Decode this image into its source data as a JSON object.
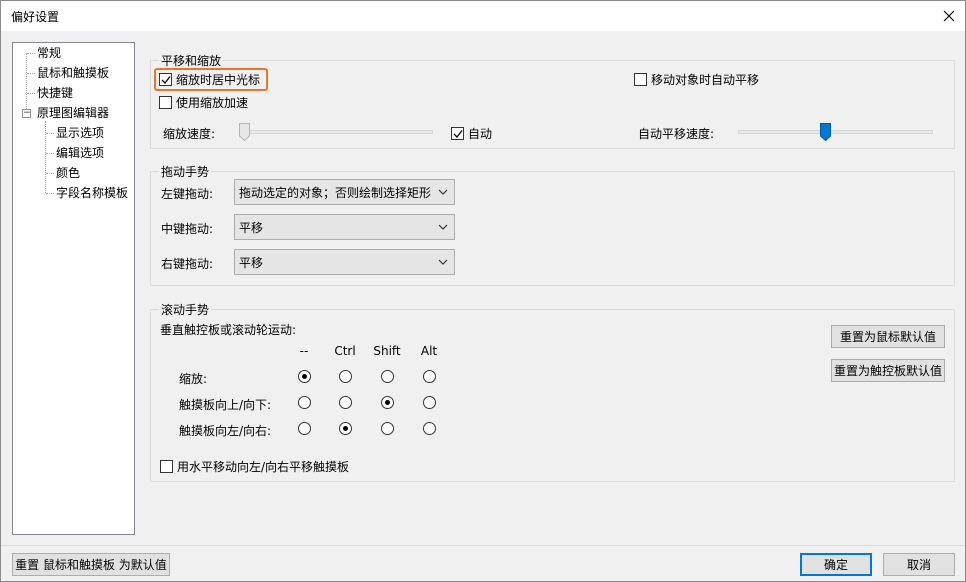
{
  "window": {
    "title": "偏好设置"
  },
  "tree": {
    "items": [
      {
        "label": "常规"
      },
      {
        "label": "鼠标和触摸板"
      },
      {
        "label": "快捷键"
      },
      {
        "label": "原理图编辑器",
        "expander": "−"
      },
      {
        "label": "显示选项"
      },
      {
        "label": "编辑选项"
      },
      {
        "label": "颜色"
      },
      {
        "label": "字段名称模板"
      }
    ]
  },
  "pan_zoom": {
    "title": "平移和缩放",
    "zoom_center_cursor": {
      "label": "缩放时居中光标",
      "checked": true
    },
    "use_zoom_accel": {
      "label": "使用缩放加速",
      "checked": false
    },
    "auto_pan_move": {
      "label": "移动对象时自动平移",
      "checked": false
    },
    "zoom_speed_label": "缩放速度:",
    "zoom_speed_value": 0.0,
    "auto": {
      "label": "自动",
      "checked": true
    },
    "auto_pan_speed_label": "自动平移速度:",
    "auto_pan_speed_value": 0.45
  },
  "drag": {
    "title": "拖动手势",
    "left": {
      "label": "左键拖动:",
      "value": "拖动选定的对象；否则绘制选择矩形"
    },
    "middle": {
      "label": "中键拖动:",
      "value": "平移"
    },
    "right": {
      "label": "右键拖动:",
      "value": "平移"
    }
  },
  "scroll": {
    "title": "滚动手势",
    "subtitle": "垂直触控板或滚动轮运动:",
    "columns": [
      "--",
      "Ctrl",
      "Shift",
      "Alt"
    ],
    "rows": [
      {
        "label": "缩放:",
        "selected": 0
      },
      {
        "label": "触摸板向上/向下:",
        "selected": 2
      },
      {
        "label": "触摸板向左/向右:",
        "selected": 1
      }
    ],
    "horizontal_pan": {
      "label": "用水平移动向左/向右平移触摸板",
      "checked": false
    },
    "reset_mouse_label": "重置为鼠标默认值",
    "reset_touchpad_label": "重置为触控板默认值"
  },
  "footer": {
    "reset_label": "重置 鼠标和触摸板 为默认值",
    "ok_label": "确定",
    "cancel_label": "取消"
  },
  "colors": {
    "accent": "#0078d7",
    "highlight": "#e8772a"
  }
}
